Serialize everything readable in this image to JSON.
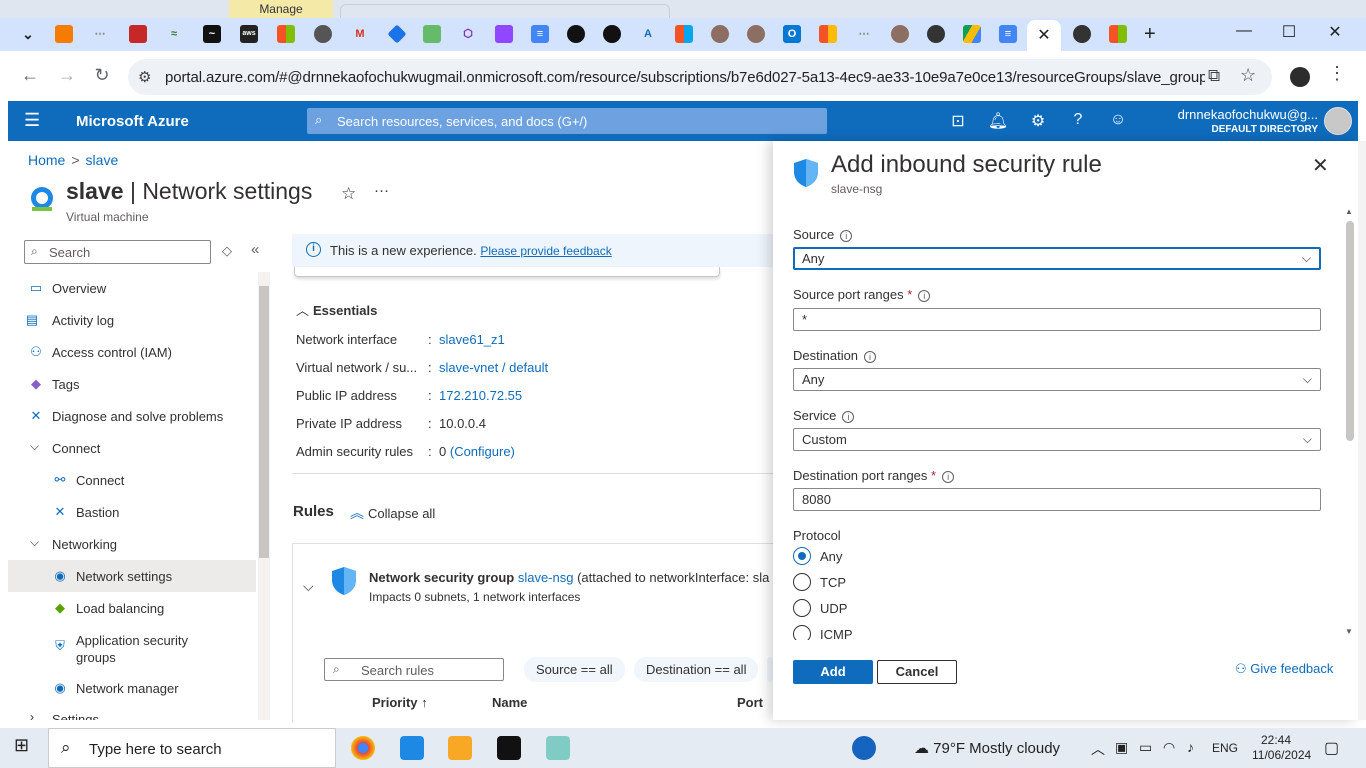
{
  "browser": {
    "manage_label": "Manage",
    "url": "portal.azure.com/#@drnnekaofochukwugmail.onmicrosoft.com/resource/subscriptions/b7e6d027-5a13-4ec9-ae33-10e9a7e0ce13/resourceGroups/slave_group/provi...",
    "active_tab_glyph": "✕",
    "new_tab_glyph": "+",
    "minimize_glyph": "—",
    "maximize_glyph": "☐",
    "close_glyph": "✕"
  },
  "azure": {
    "brand": "Microsoft Azure",
    "search_placeholder": "Search resources, services, and docs (G+/)",
    "user_name": "drnnekaofochukwu@g...",
    "directory": "DEFAULT DIRECTORY"
  },
  "breadcrumb": {
    "home": "Home",
    "separator": ">",
    "current": "slave"
  },
  "page": {
    "title_bold": "slave",
    "title_rest": " | Network settings",
    "subtitle": "Virtual machine",
    "star_glyph": "☆",
    "more_glyph": "···"
  },
  "sidebar": {
    "search_placeholder": "Search",
    "items": [
      {
        "label": "Overview",
        "icon": "monitor-icon",
        "color": "#0f6cbd"
      },
      {
        "label": "Activity log",
        "icon": "log-icon",
        "color": "#0f6cbd"
      },
      {
        "label": "Access control (IAM)",
        "icon": "people-icon",
        "color": "#0f6cbd"
      },
      {
        "label": "Tags",
        "icon": "tag-icon",
        "color": "#8661c5"
      },
      {
        "label": "Diagnose and solve problems",
        "icon": "wrench-icon",
        "color": "#0f6cbd"
      },
      {
        "label": "Connect",
        "group": true
      },
      {
        "label": "Connect",
        "icon": "connect-icon",
        "color": "#0f6cbd"
      },
      {
        "label": "Bastion",
        "icon": "bastion-icon",
        "color": "#0f6cbd"
      },
      {
        "label": "Networking",
        "group": true
      },
      {
        "label": "Network settings",
        "icon": "network-icon",
        "color": "#0f6cbd",
        "selected": true
      },
      {
        "label": "Load balancing",
        "icon": "load-balancer-icon",
        "color": "#57a300"
      },
      {
        "label": "Application security groups",
        "icon": "shield-icon",
        "color": "#0f6cbd"
      },
      {
        "label": "Network manager",
        "icon": "network-manager-icon",
        "color": "#0f6cbd"
      },
      {
        "label": "Settings",
        "group": true
      }
    ]
  },
  "banner": {
    "text": "This is a new experience.",
    "link": "Please provide feedback"
  },
  "essentials": {
    "heading": "Essentials",
    "rows": [
      {
        "key": "Network interface",
        "value": "slave61_z1",
        "link": true
      },
      {
        "key": "Virtual network / su...",
        "value": "slave-vnet / default",
        "link": true
      },
      {
        "key": "Public IP address",
        "value": "172.210.72.55",
        "link": true
      },
      {
        "key": "Private IP address",
        "value": "10.0.0.4",
        "link": false
      },
      {
        "key": "Admin security rules",
        "value": "0",
        "link_suffix": "(Configure)"
      }
    ]
  },
  "rules": {
    "heading": "Rules",
    "collapse_all": "Collapse all",
    "nsg_prefix": "Network security group",
    "nsg_name": "slave-nsg",
    "nsg_suffix": "(attached to networkInterface: sla",
    "nsg_impacts": "Impacts 0 subnets, 1 network interfaces",
    "search_placeholder": "Search rules",
    "filter_source": "Source == all",
    "filter_destination": "Destination == all",
    "col_priority": "Priority ↑",
    "col_name": "Name",
    "col_port": "Port"
  },
  "panel": {
    "title": "Add inbound security rule",
    "subtitle": "slave-nsg",
    "source_label": "Source",
    "source_value": "Any",
    "source_port_label": "Source port ranges",
    "source_port_value": "*",
    "destination_label": "Destination",
    "destination_value": "Any",
    "service_label": "Service",
    "service_value": "Custom",
    "dest_port_label": "Destination port ranges",
    "dest_port_value": "8080",
    "protocol_label": "Protocol",
    "protocols": [
      "Any",
      "TCP",
      "UDP",
      "ICMP"
    ],
    "required_mark": "*",
    "add_button": "Add",
    "cancel_button": "Cancel",
    "feedback": "Give feedback"
  },
  "taskbar": {
    "search_placeholder": "Type here to search",
    "weather": "79°F  Mostly cloudy",
    "language": "ENG",
    "time": "22:44",
    "date": "11/06/2024"
  },
  "colors": {
    "azure_blue": "#0f6cbd",
    "tab_bar": "#d3e3fd"
  }
}
